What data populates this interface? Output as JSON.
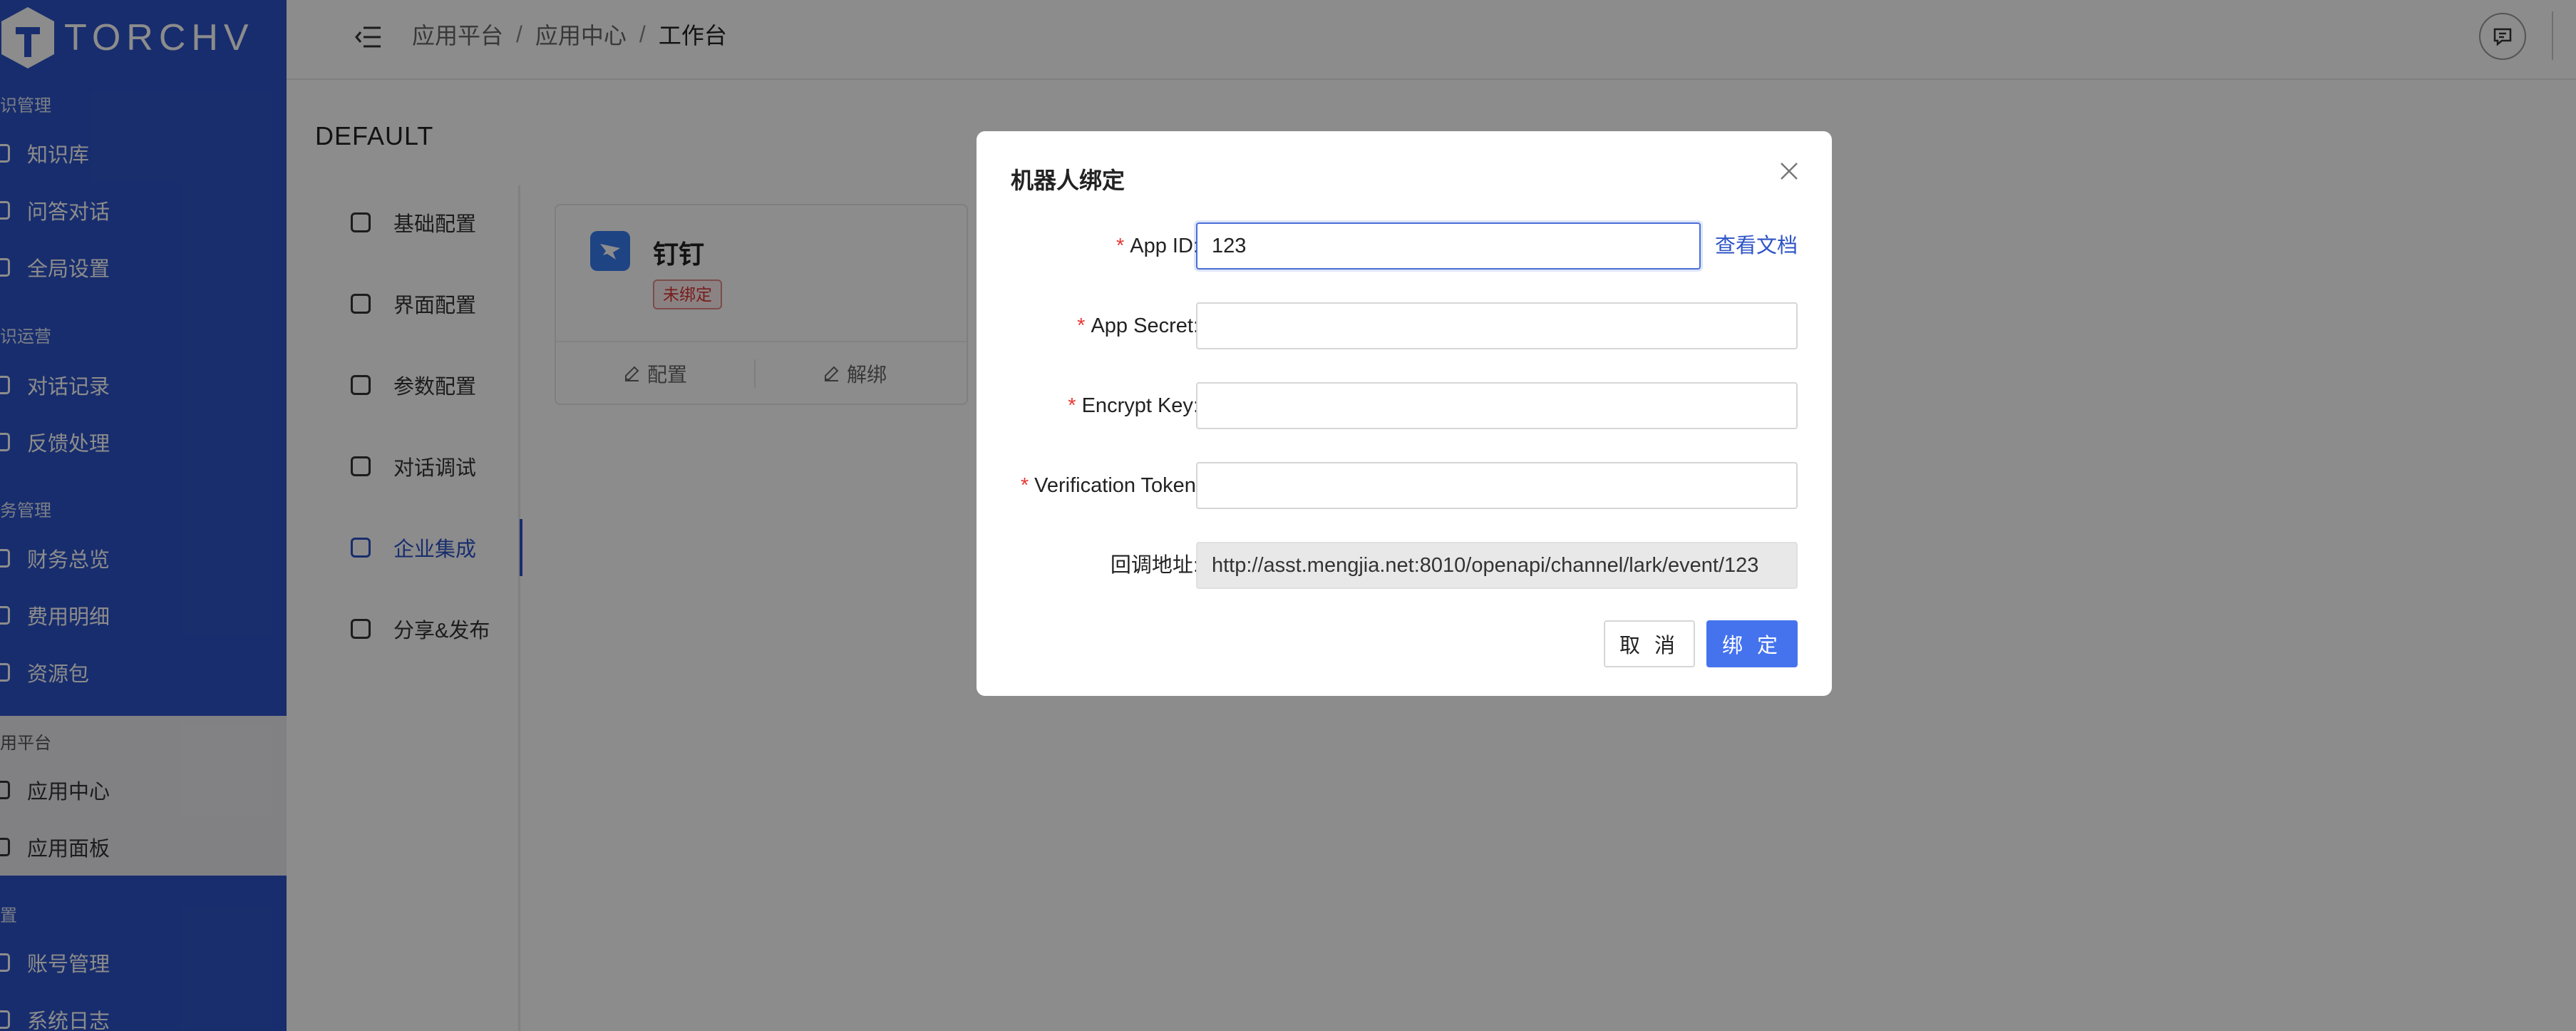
{
  "app": {
    "logo_text": "TORCHV"
  },
  "sidebar": {
    "groups": [
      {
        "title": "识管理",
        "items": [
          "知识库",
          "问答对话",
          "全局设置"
        ]
      },
      {
        "title": "识运营",
        "items": [
          "对话记录",
          "反馈处理"
        ]
      },
      {
        "title": "务管理",
        "items": [
          "财务总览",
          "费用明细",
          "资源包"
        ]
      },
      {
        "title": "用平台",
        "items": [
          "应用中心",
          "应用面板"
        ]
      },
      {
        "title": "置",
        "items": [
          "账号管理",
          "系统日志"
        ]
      }
    ]
  },
  "header": {
    "breadcrumb": [
      "应用平台",
      "应用中心",
      "工作台"
    ],
    "separator": "/"
  },
  "page": {
    "title": "DEFAULT"
  },
  "menu": {
    "items": [
      "基础配置",
      "界面配置",
      "参数配置",
      "对话调试",
      "企业集成",
      "分享&发布"
    ],
    "active_index": 4
  },
  "card": {
    "title": "钉钉",
    "status": "未绑定",
    "actions": [
      "配置",
      "解绑"
    ]
  },
  "modal": {
    "title": "机器人绑定",
    "fields": [
      {
        "label": "App ID",
        "required": true,
        "value": "123",
        "colon": ":"
      },
      {
        "label": "App Secret",
        "required": true,
        "value": "",
        "colon": ":"
      },
      {
        "label": "Encrypt Key",
        "required": true,
        "value": "",
        "colon": ":"
      },
      {
        "label": "Verification Token",
        "required": true,
        "value": "",
        "colon": ":"
      },
      {
        "label": "回调地址",
        "required": false,
        "value": "http://asst.mengjia.net:8010/openapi/channel/lark/event/123",
        "colon": ":"
      }
    ],
    "doc_link": "查看文档",
    "cancel_label": "取 消",
    "bind_label": "绑 定",
    "required_mark": "*"
  },
  "colors": {
    "sidebar_bg": "#2d53c6",
    "primary": "#4573ee",
    "danger": "#e53935"
  }
}
